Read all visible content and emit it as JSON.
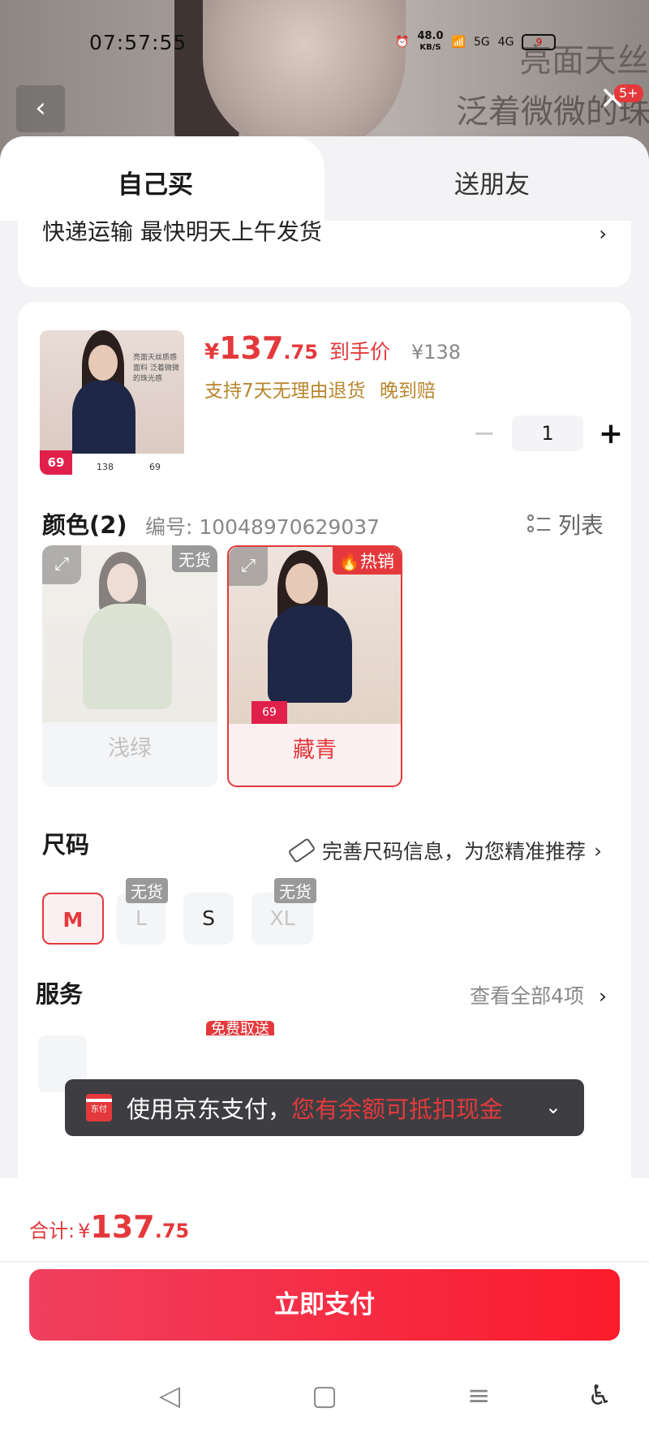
{
  "status_bar": {
    "time": "07:57:55",
    "net_speed": "48.0",
    "net_unit": "KB/S",
    "sig1": "5G",
    "sig2": "4G",
    "battery": "9"
  },
  "background": {
    "title_line1": "亮面天丝",
    "title_line2": "泛着微微的珠",
    "notification_count": "5+"
  },
  "tabs": {
    "self": "自己买",
    "gift": "送朋友"
  },
  "address": {
    "text": "快递运输 最快明天上午发货"
  },
  "product": {
    "thumb_caption": "亮面天丝质感面料 泛着微微的珠光感",
    "thumb_price": "69",
    "thumb_price2": "138",
    "thumb_price3": "69",
    "price_symbol": "¥",
    "price_int": "137",
    "price_dec": ".75",
    "price_label": "到手价",
    "original_price": "¥138",
    "promo1": "支持7天无理由退货",
    "promo2": "晚到赔",
    "quantity": "1"
  },
  "color_section": {
    "title": "颜色(2)",
    "code": "编号: 10048970629037",
    "list_label": "列表",
    "options": [
      {
        "label": "浅绿",
        "tag": "无货"
      },
      {
        "label": "藏青",
        "tag": "热销"
      }
    ]
  },
  "size_section": {
    "title": "尺码",
    "hint": "完善尺码信息，为您精准推荐",
    "options": [
      {
        "label": "M"
      },
      {
        "label": "L",
        "tag": "无货"
      },
      {
        "label": "S"
      },
      {
        "label": "XL",
        "tag": "无货"
      }
    ]
  },
  "service_section": {
    "title": "服务",
    "more": "查看全部4项",
    "free_tag": "免费取送"
  },
  "pay_toast": {
    "logo": "东付",
    "text": "使用京东支付，",
    "highlight": "您有余额可抵扣现金"
  },
  "footer": {
    "total_label": "合计:",
    "total_symbol": "¥",
    "total_int": "137",
    "total_dec": ".75",
    "pay_button": "立即支付"
  },
  "colors": {
    "accent": "#e4393c",
    "promo": "#b7862c"
  }
}
